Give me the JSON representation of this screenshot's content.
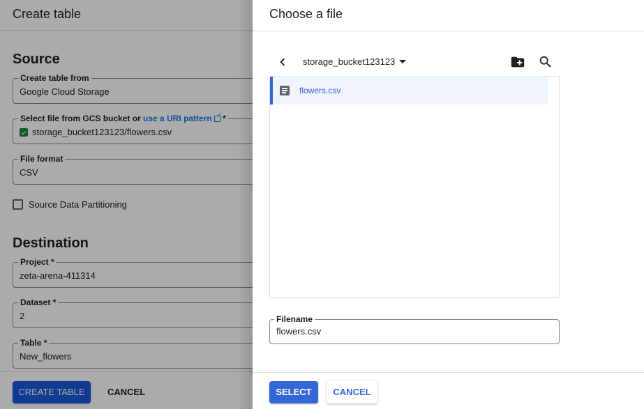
{
  "background_page": {
    "title": "Create table",
    "source": {
      "heading": "Source",
      "create_from": {
        "label": "Create table from",
        "value": "Google Cloud Storage"
      },
      "gcs_file": {
        "label_prefix": "Select file from GCS bucket or ",
        "label_link": "use a URI pattern",
        "label_suffix": " *",
        "value": "storage_bucket123123/flowers.csv",
        "valid": true
      },
      "file_format": {
        "label": "File format",
        "value": "CSV"
      },
      "partitioning": {
        "label": "Source Data Partitioning",
        "checked": false
      }
    },
    "destination": {
      "heading": "Destination",
      "project": {
        "label": "Project *",
        "value": "zeta-arena-411314"
      },
      "dataset": {
        "label": "Dataset *",
        "value": "2"
      },
      "table": {
        "label": "Table *",
        "value": "New_flowers"
      }
    },
    "footer": {
      "create_label": "CREATE TABLE",
      "cancel_label": "CANCEL"
    }
  },
  "file_chooser": {
    "title": "Choose a file",
    "bucket": "storage_bucket123123",
    "icons": {
      "back": "chevron-left-icon",
      "new_folder": "create-new-folder-icon",
      "search": "search-icon",
      "file": "document-icon"
    },
    "files": [
      {
        "name": "flowers.csv",
        "selected": true
      }
    ],
    "filename": {
      "label": "Filename",
      "value": "flowers.csv"
    },
    "footer": {
      "select_label": "SELECT",
      "cancel_label": "CANCEL"
    },
    "colors": {
      "accent": "#3367d6",
      "selected_row_bg": "#eef3fd"
    }
  }
}
